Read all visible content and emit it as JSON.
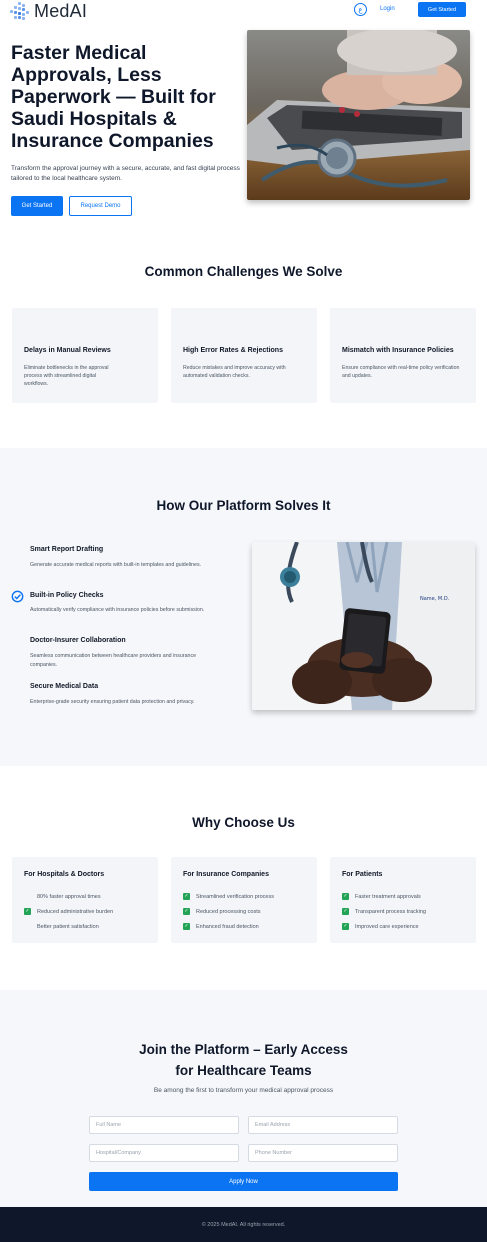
{
  "header": {
    "logo_text": "MedAI",
    "lang_icon": "language-icon",
    "lang_symbol": "ع",
    "login": "Login",
    "cta": "Get Started"
  },
  "hero": {
    "title": "Faster Medical Approvals, Less Paperwork — Built for Saudi Hospitals & Insurance Companies",
    "subtitle": "Transform the approval journey with a secure, accurate, and fast digital process tailored to the local healthcare system.",
    "primary_button": "Get Started",
    "secondary_button": "Request Demo",
    "image": "laptop-stethoscope-photo"
  },
  "challenges": {
    "title": "Common Challenges We Solve",
    "cards": [
      {
        "title": "Delays in Manual Reviews",
        "desc": "Eliminate bottlenecks in the approval process with streamlined digital workflows."
      },
      {
        "title": "High Error Rates & Rejections",
        "desc": "Reduce mistakes and improve accuracy with automated validation checks."
      },
      {
        "title": "Mismatch with Insurance Policies",
        "desc": "Ensure compliance with real-time policy verification and updates."
      }
    ]
  },
  "platform": {
    "title": "How Our Platform Solves It",
    "features": [
      {
        "title": "Smart Report Drafting",
        "desc": "Generate accurate medical reports with built-in templates and guidelines."
      },
      {
        "title": "Built-in Policy Checks",
        "desc": "Automatically verify compliance with insurance policies before submission.",
        "icon": "check-circle-icon"
      },
      {
        "title": "Doctor-Insurer Collaboration",
        "desc": "Seamless communication between healthcare providers and insurance companies."
      },
      {
        "title": "Secure Medical Data",
        "desc": "Enterprise-grade security ensuring patient data protection and privacy."
      }
    ],
    "image": "doctor-smartphone-photo"
  },
  "why": {
    "title": "Why Choose Us",
    "cards": [
      {
        "title": "For Hospitals & Doctors",
        "items": [
          {
            "text": "80% faster approval times",
            "checked": false
          },
          {
            "text": "Reduced administrative burden",
            "checked": true
          },
          {
            "text": "Better patient satisfaction",
            "checked": false
          }
        ]
      },
      {
        "title": "For Insurance Companies",
        "items": [
          {
            "text": "Streamlined verification process",
            "checked": true
          },
          {
            "text": "Reduced processing costs",
            "checked": true
          },
          {
            "text": "Enhanced fraud detection",
            "checked": true
          }
        ]
      },
      {
        "title": "For Patients",
        "items": [
          {
            "text": "Faster treatment approvals",
            "checked": true
          },
          {
            "text": "Transparent process tracking",
            "checked": true
          },
          {
            "text": "Improved care experience",
            "checked": true
          }
        ]
      }
    ]
  },
  "join": {
    "title_line1": "Join the Platform – Early Access",
    "title_line2": "for Healthcare Teams",
    "subtitle": "Be among the first to transform your medical approval process",
    "fields": {
      "full_name": "Full Name",
      "email": "Email Address",
      "company": "Hospital/Company",
      "phone": "Phone Number"
    },
    "button": "Apply Now"
  },
  "footer": {
    "text": "© 2025 MedAI. All rights reserved."
  },
  "colors": {
    "primary": "#0b74f3",
    "check_green": "#22a355",
    "footer_bg": "#0f172a",
    "section_bg": "#f5f7fa"
  }
}
